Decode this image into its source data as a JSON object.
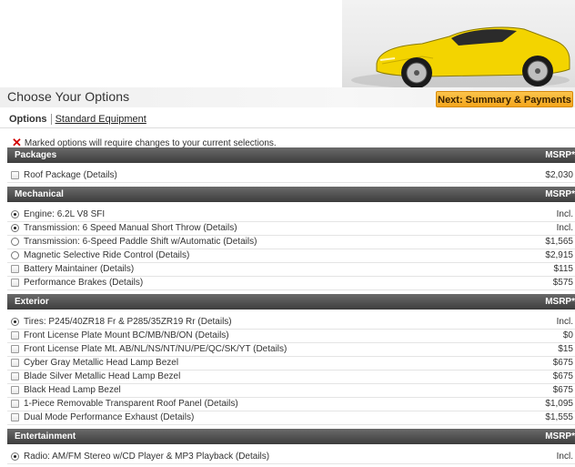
{
  "page": {
    "title": "Choose Your Options",
    "next_button": "Next: Summary & Payments"
  },
  "tabs": [
    {
      "label": "Options"
    },
    {
      "label": "Standard Equipment"
    }
  ],
  "notice": {
    "icon": "red-x-icon",
    "text": "Marked options will require changes to your current selections."
  },
  "colors": {
    "section_header": "#4a4a4a",
    "next_button": "#f6b02f",
    "notice_x": "#d20000",
    "car_body": "#f3d400"
  },
  "sections": [
    {
      "name": "Packages",
      "msrp_label": "MSRP*",
      "rows": [
        {
          "control": "checkbox",
          "checked": false,
          "label": "Roof Package",
          "details": "(Details)",
          "price": "$2,030"
        }
      ]
    },
    {
      "name": "Mechanical",
      "msrp_label": "MSRP*",
      "rows": [
        {
          "control": "radio",
          "checked": true,
          "label": "Engine: 6.2L V8 SFI",
          "details": "",
          "price": "Incl."
        },
        {
          "control": "radio",
          "checked": true,
          "label": "Transmission: 6 Speed Manual Short Throw",
          "details": "(Details)",
          "price": "Incl."
        },
        {
          "control": "radio",
          "checked": false,
          "label": "Transmission: 6-Speed Paddle Shift w/Automatic",
          "details": "(Details)",
          "price": "$1,565"
        },
        {
          "control": "radio",
          "checked": false,
          "label": "Magnetic Selective Ride Control",
          "details": "(Details)",
          "price": "$2,915"
        },
        {
          "control": "checkbox",
          "checked": false,
          "label": "Battery Maintainer",
          "details": "(Details)",
          "price": "$115"
        },
        {
          "control": "checkbox",
          "checked": false,
          "label": "Performance Brakes",
          "details": "(Details)",
          "price": "$575"
        }
      ]
    },
    {
      "name": "Exterior",
      "msrp_label": "MSRP*",
      "rows": [
        {
          "control": "radio",
          "checked": true,
          "label": "Tires: P245/40ZR18 Fr & P285/35ZR19 Rr",
          "details": "(Details)",
          "price": "Incl."
        },
        {
          "control": "checkbox",
          "checked": false,
          "label": "Front License Plate Mount BC/MB/NB/ON",
          "details": "(Details)",
          "price": "$0"
        },
        {
          "control": "checkbox",
          "checked": false,
          "label": "Front License Plate Mt. AB/NL/NS/NT/NU/PE/QC/SK/YT",
          "details": "(Details)",
          "price": "$15"
        },
        {
          "control": "checkbox",
          "checked": false,
          "label": "Cyber Gray Metallic Head Lamp Bezel",
          "details": "",
          "price": "$675"
        },
        {
          "control": "checkbox",
          "checked": false,
          "label": "Blade Silver Metallic Head Lamp Bezel",
          "details": "",
          "price": "$675"
        },
        {
          "control": "checkbox",
          "checked": false,
          "label": "Black Head Lamp Bezel",
          "details": "",
          "price": "$675"
        },
        {
          "control": "checkbox",
          "checked": false,
          "label": "1-Piece Removable Transparent Roof Panel",
          "details": "(Details)",
          "price": "$1,095"
        },
        {
          "control": "checkbox",
          "checked": false,
          "label": "Dual Mode Performance Exhaust",
          "details": "(Details)",
          "price": "$1,555"
        }
      ]
    },
    {
      "name": "Entertainment",
      "msrp_label": "MSRP*",
      "rows": [
        {
          "control": "radio",
          "checked": true,
          "label": "Radio: AM/FM Stereo w/CD Player & MP3 Playback",
          "details": "(Details)",
          "price": "Incl."
        }
      ]
    }
  ]
}
